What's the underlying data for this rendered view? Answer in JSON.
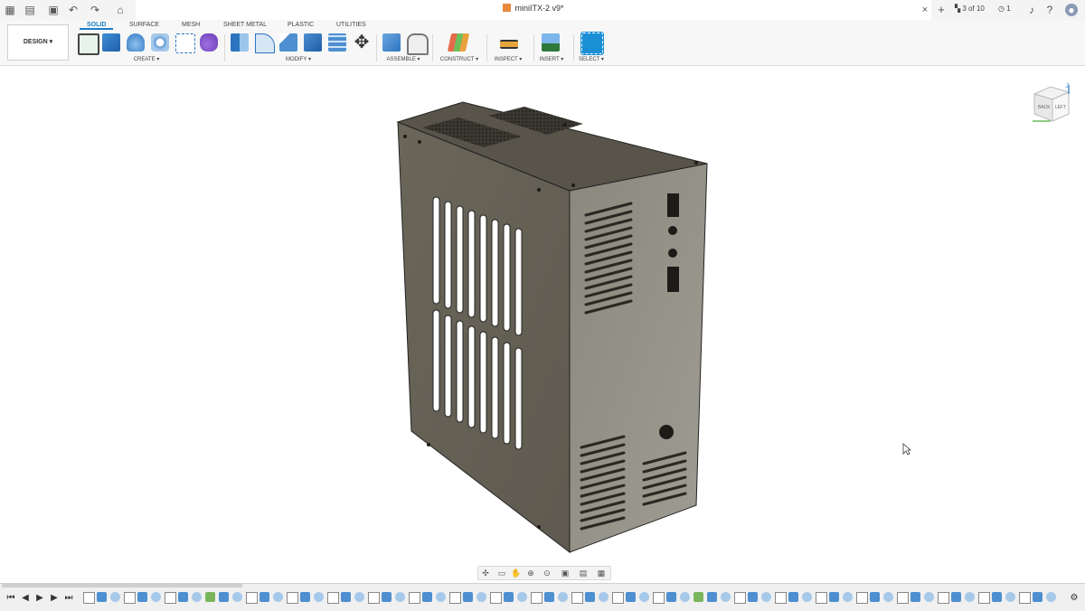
{
  "titlebar": {
    "document_title": "miniITX-2 v9*",
    "close_tab": "×",
    "add_tab": "+",
    "job_status": "3 of 10",
    "notifications_count": "1"
  },
  "toolbar": {
    "mode_button": "DESIGN ▾",
    "tabs": [
      {
        "label": "SOLID",
        "active": true
      },
      {
        "label": "SURFACE",
        "active": false
      },
      {
        "label": "MESH",
        "active": false
      },
      {
        "label": "SHEET METAL",
        "active": false
      },
      {
        "label": "PLASTIC",
        "active": false
      },
      {
        "label": "UTILITIES",
        "active": false
      }
    ],
    "groups": [
      {
        "label": "CREATE ▾"
      },
      {
        "label": "MODIFY ▾"
      },
      {
        "label": "ASSEMBLE ▾"
      },
      {
        "label": "CONSTRUCT ▾"
      },
      {
        "label": "INSPECT ▾"
      },
      {
        "label": "INSERT ▾"
      },
      {
        "label": "SELECT ▾"
      }
    ]
  },
  "viewcube": {
    "left": "LEFT",
    "back": "BACK",
    "axis": "Z"
  },
  "colors": {
    "accent": "#1a7fc4",
    "case_body": "#6e6a5d",
    "case_front": "#8a877d",
    "case_top": "#5f5b50"
  },
  "icons": {
    "grid": "grid-icon",
    "file": "file-icon",
    "save": "save-icon",
    "undo": "undo-icon",
    "redo": "redo-icon",
    "home": "home-icon",
    "bell": "bell-icon",
    "help": "help-icon",
    "avatar": "avatar-icon"
  }
}
